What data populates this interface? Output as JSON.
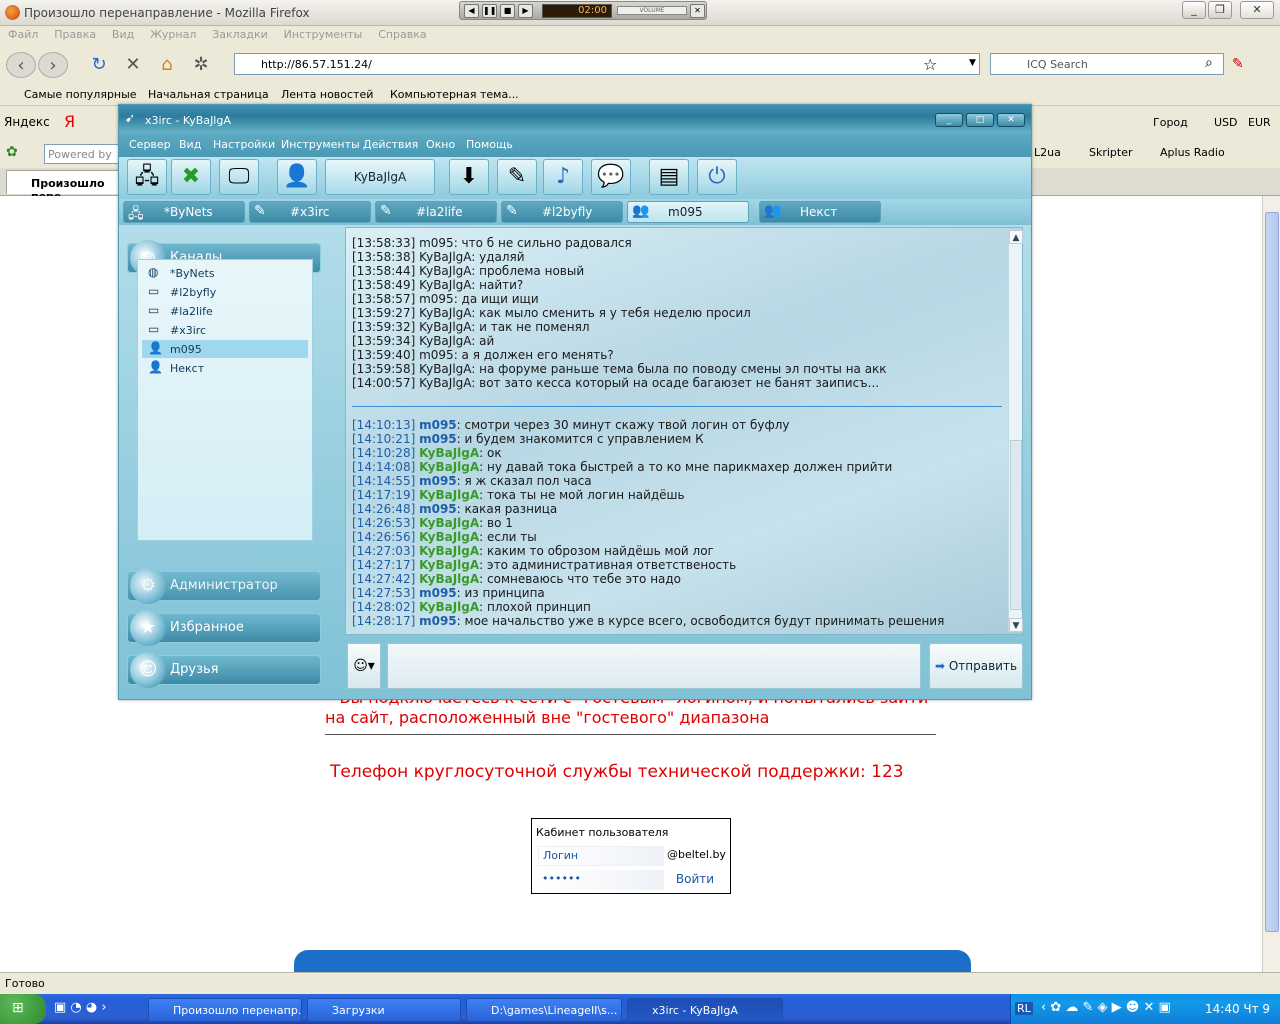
{
  "browser": {
    "title": "Произошло перенаправление - Mozilla Firefox",
    "menu": [
      "Файл",
      "Правка",
      "Вид",
      "Журнал",
      "Закладки",
      "Инструменты",
      "Справка"
    ],
    "url": "http://86.57.151.24/",
    "search_placeholder": "ICQ Search",
    "bookmarks": [
      "Самые популярные",
      "Начальная страница",
      "Лента новостей",
      "Компьютерная тема..."
    ],
    "yandex_label": "Яндекс",
    "yandex_letter": "Я",
    "city": "Город",
    "usd": "USD",
    "eur": "EUR",
    "powered_by": "Powered by",
    "toolbar_links": [
      "L2ua",
      "Skripter",
      "Aplus Radio"
    ],
    "tab_title": "Произошло пере",
    "status": "Готово"
  },
  "player": {
    "time": "02:00",
    "volume_label": "VOLUME"
  },
  "page": {
    "red_text": "• Вы подключаетесь к сети с \"гостевым\" логином, и попытались зайти на сайт, расположенный вне \"гостевого\" диапазона",
    "phone_text": "Телефон круглосуточной службы технической поддержки: 123",
    "cabinet_title": "Кабинет пользователя",
    "login_placeholder": "Логин",
    "domain": "@beltel.by",
    "password_mask": "••••••",
    "login_button": "Войти"
  },
  "irc": {
    "title": "x3irc - KyBaJlgA",
    "menu": [
      "Сервер",
      "Вид",
      "Настройки",
      "Инструменты",
      "Действия",
      "Окно",
      "Помощь"
    ],
    "nick": "KyBaJlgA",
    "tabs": [
      {
        "label": "*ByNets",
        "icon": "network-icon"
      },
      {
        "label": "#x3irc",
        "icon": "channel-icon"
      },
      {
        "label": "#la2life",
        "icon": "channel-icon"
      },
      {
        "label": "#l2byfly",
        "icon": "channel-icon"
      },
      {
        "label": "m095",
        "icon": "user-icon",
        "selected": true
      },
      {
        "label": "Некст",
        "icon": "user-icon"
      }
    ],
    "left_panel": {
      "channels_header": "Каналы",
      "admin_header": "Администратор",
      "favorites_header": "Избранное",
      "friends_header": "Друзья",
      "items": [
        "*ByNets",
        "#l2byfly",
        "#la2life",
        "#x3irc",
        "m095",
        "Некст"
      ]
    },
    "old_lines": [
      {
        "ts": "[13:58:33]",
        "nick": "m095",
        "text": "что б не сильно радовался"
      },
      {
        "ts": "[13:58:38]",
        "nick": "KyBaJlgA",
        "text": "удаляй"
      },
      {
        "ts": "[13:58:44]",
        "nick": "KyBaJlgA",
        "text": "проблема новый"
      },
      {
        "ts": "[13:58:49]",
        "nick": "KyBaJlgA",
        "text": "найти?"
      },
      {
        "ts": "[13:58:57]",
        "nick": "m095",
        "text": "да ищи ищи"
      },
      {
        "ts": "[13:59:27]",
        "nick": "KyBaJlgA",
        "text": "как мыло сменить я у тебя неделю просил"
      },
      {
        "ts": "[13:59:32]",
        "nick": "KyBaJlgA",
        "text": "и так не поменял"
      },
      {
        "ts": "[13:59:34]",
        "nick": "KyBaJlgA",
        "text": "ай"
      },
      {
        "ts": "[13:59:40]",
        "nick": "m095",
        "text": "а я должен его менять?"
      },
      {
        "ts": "[13:59:58]",
        "nick": "KyBaJlgA",
        "text": "на форуме раньше тема была по поводу смены  эл почты на акк"
      },
      {
        "ts": "[14:00:57]",
        "nick": "KyBaJlgA",
        "text": "вот зато кесса который на осаде багаюзет не банят заиписъ..."
      }
    ],
    "new_lines": [
      {
        "ts": "[14:10:13]",
        "nick": "m095",
        "text": "смотри через 30 минут скажу твой логин от буфлу"
      },
      {
        "ts": "[14:10:21]",
        "nick": "m095",
        "text": "и будем знакомится с управлением К"
      },
      {
        "ts": "[14:10:28]",
        "nick": "KyBaJlgA",
        "text": " ок"
      },
      {
        "ts": "[14:14:08]",
        "nick": "KyBaJlgA",
        "text": "ну давай тока быстрей а то ко мне парикмахер должен прийти"
      },
      {
        "ts": "[14:14:55]",
        "nick": "m095",
        "text": "я ж сказал пол часа"
      },
      {
        "ts": "[14:17:19]",
        "nick": "KyBaJlgA",
        "text": "тока ты не мой логин найдёшь"
      },
      {
        "ts": "[14:26:48]",
        "nick": "m095",
        "text": "какая разница"
      },
      {
        "ts": "[14:26:53]",
        "nick": "KyBaJlgA",
        "text": "во 1"
      },
      {
        "ts": "[14:26:56]",
        "nick": "KyBaJlgA",
        "text": "если ты"
      },
      {
        "ts": "[14:27:03]",
        "nick": "KyBaJlgA",
        "text": "каким то оброзом найдёшь мой лог"
      },
      {
        "ts": "[14:27:17]",
        "nick": "KyBaJlgA",
        "text": "это административная ответственость"
      },
      {
        "ts": "[14:27:42]",
        "nick": "KyBaJlgA",
        "text": "сомневаюсь что тебе это надо"
      },
      {
        "ts": "[14:27:53]",
        "nick": "m095",
        "text": "из принципа"
      },
      {
        "ts": "[14:28:02]",
        "nick": "KyBaJlgA",
        "text": "плохой принцип"
      },
      {
        "ts": "[14:28:17]",
        "nick": "m095",
        "text": "мое начальство уже в курсе всего, освободится будут принимать решения"
      }
    ],
    "send_label": "Отправить"
  },
  "taskbar": {
    "buttons": [
      "Произошло перенапр...",
      "Загрузки",
      "D:\\games\\LineageII\\s...",
      "x3irc - KyBaJlgA"
    ],
    "lang": "RL",
    "clock": "14:40 Чт 9"
  },
  "colors": {
    "irc_accent": "#3c90b0",
    "chat_ts": "#1d5ea8",
    "chat_kuv": "#3a9b2a",
    "alert_red": "#e00000"
  }
}
